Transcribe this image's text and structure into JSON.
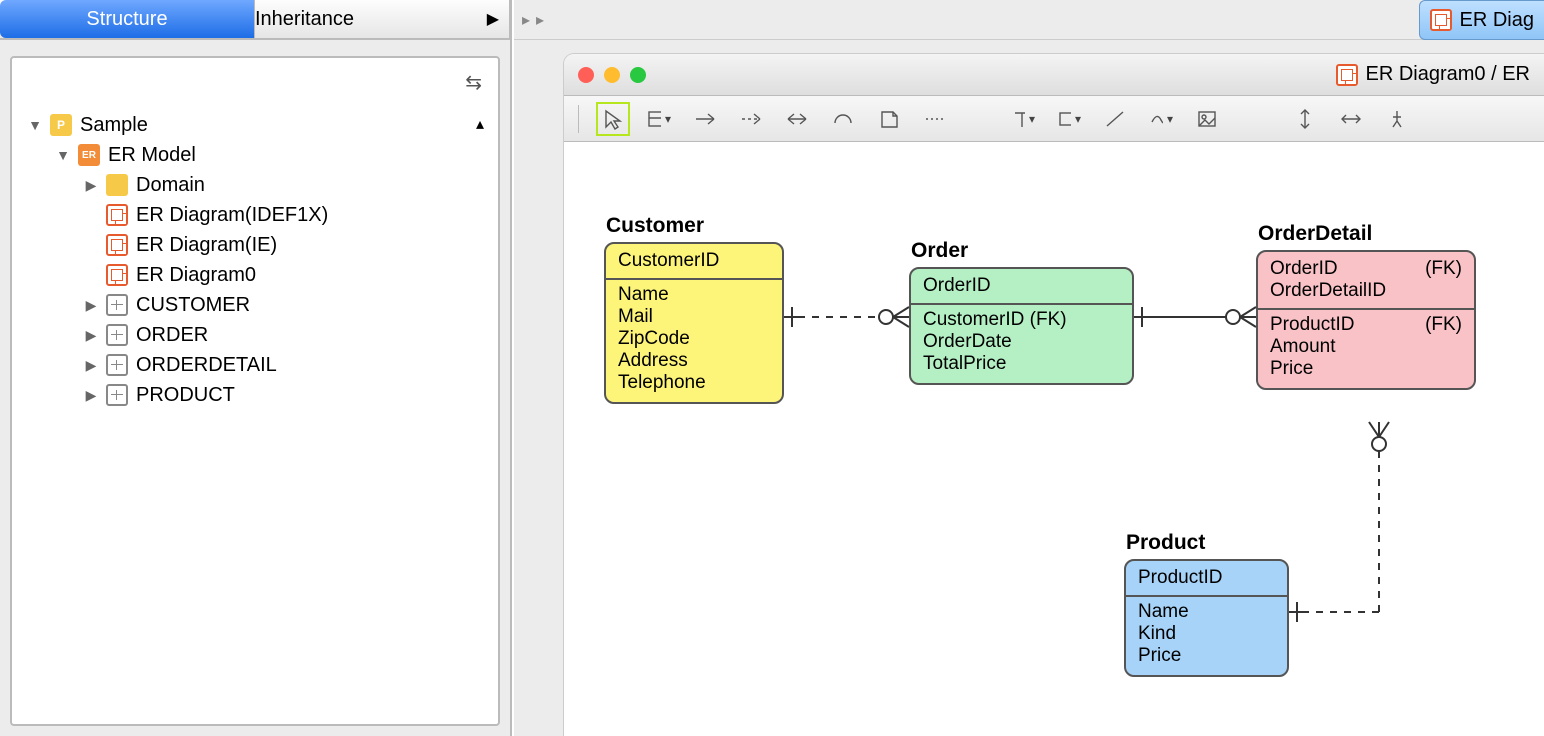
{
  "sidebar": {
    "tabs": {
      "structure": "Structure",
      "inheritance": "Inheritance"
    },
    "tree": {
      "root": "Sample",
      "model": "ER Model",
      "domain": "Domain",
      "diagrams": [
        "ER Diagram(IDEF1X)",
        "ER Diagram(IE)",
        "ER Diagram0"
      ],
      "tables": [
        "CUSTOMER",
        "ORDER",
        "ORDERDETAIL",
        "PRODUCT"
      ]
    }
  },
  "docTab": "ER Diag",
  "window": {
    "title": "ER Diagram0 / ER"
  },
  "entities": {
    "customer": {
      "title": "Customer",
      "pk": [
        "CustomerID"
      ],
      "attrs": [
        "Name",
        "Mail",
        "ZipCode",
        "Address",
        "Telephone"
      ]
    },
    "order": {
      "title": "Order",
      "pk": [
        "OrderID"
      ],
      "attrs": [
        "CustomerID (FK)",
        "OrderDate",
        "TotalPrice"
      ]
    },
    "orderdetail": {
      "title": "OrderDetail",
      "pk": [
        {
          "name": "OrderID",
          "fk": "(FK)"
        },
        {
          "name": "OrderDetailID",
          "fk": ""
        }
      ],
      "attrs": [
        {
          "name": "ProductID",
          "fk": "(FK)"
        },
        {
          "name": "Amount",
          "fk": ""
        },
        {
          "name": "Price",
          "fk": ""
        }
      ]
    },
    "product": {
      "title": "Product",
      "pk": [
        "ProductID"
      ],
      "attrs": [
        "Name",
        "Kind",
        "Price"
      ]
    }
  }
}
